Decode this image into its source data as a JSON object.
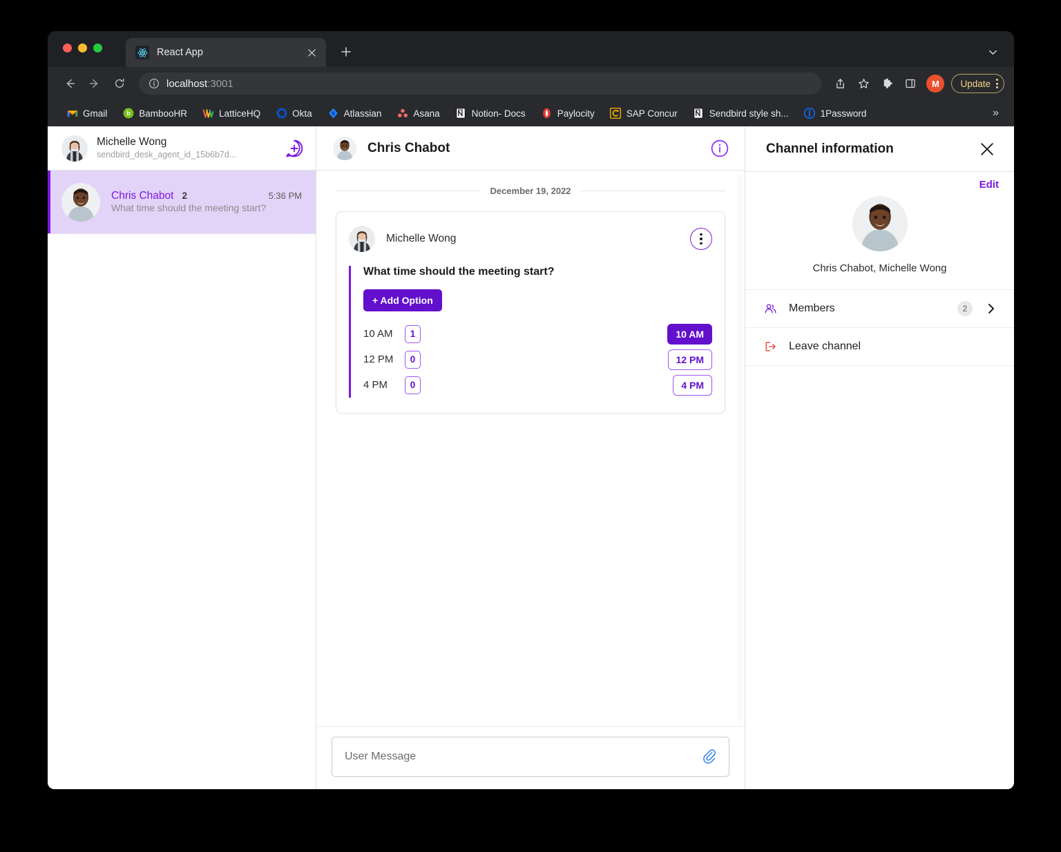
{
  "browser": {
    "tab": {
      "title": "React App",
      "favicon": "react-icon"
    },
    "url": {
      "host": "localhost",
      "port": ":3001"
    },
    "update_label": "Update",
    "profile_initial": "M",
    "bookmarks": [
      {
        "label": "Gmail",
        "icon": "gmail-icon"
      },
      {
        "label": "BambooHR",
        "icon": "bamboohr-icon"
      },
      {
        "label": "LatticeHQ",
        "icon": "latticehq-icon"
      },
      {
        "label": "Okta",
        "icon": "okta-icon"
      },
      {
        "label": "Atlassian",
        "icon": "atlassian-icon"
      },
      {
        "label": "Asana",
        "icon": "asana-icon"
      },
      {
        "label": "Notion- Docs",
        "icon": "notion-icon"
      },
      {
        "label": "Paylocity",
        "icon": "paylocity-icon"
      },
      {
        "label": "SAP Concur",
        "icon": "sapconcur-icon"
      },
      {
        "label": "Sendbird style sh...",
        "icon": "notion-icon"
      },
      {
        "label": "1Password",
        "icon": "onepassword-icon"
      }
    ],
    "bookmarks_overflow": "»"
  },
  "channel_list": {
    "current_user": {
      "name": "Michelle Wong",
      "user_id": "sendbird_desk_agent_id_15b6b7d..."
    },
    "items": [
      {
        "name": "Chris Chabot",
        "member_count": "2",
        "time": "5:36 PM",
        "preview": "What time should the meeting start?",
        "selected": true
      }
    ]
  },
  "conversation": {
    "title": "Chris Chabot",
    "date_separator": "December 19, 2022",
    "poll": {
      "author": "Michelle Wong",
      "question": "What time should the meeting start?",
      "add_option_label": "+ Add Option",
      "options": [
        {
          "label": "10 AM",
          "count": "1",
          "vote_label": "10 AM",
          "selected": true
        },
        {
          "label": "12 PM",
          "count": "0",
          "vote_label": "12 PM",
          "selected": false
        },
        {
          "label": "4 PM",
          "count": "0",
          "vote_label": "4 PM",
          "selected": false
        }
      ]
    },
    "composer": {
      "placeholder": "User Message"
    }
  },
  "info_panel": {
    "title": "Channel information",
    "edit_label": "Edit",
    "members_text": "Chris Chabot, Michelle Wong",
    "rows": [
      {
        "label": "Members",
        "badge": "2",
        "icon": "members-icon"
      },
      {
        "label": "Leave channel",
        "badge": "",
        "icon": "leave-icon"
      }
    ]
  },
  "colors": {
    "accent": "#7B17E0",
    "accent_dark": "#6210CC",
    "accent_light": "#9B56F0",
    "selected_row": "#E2D4F8",
    "danger": "#E8402A"
  }
}
